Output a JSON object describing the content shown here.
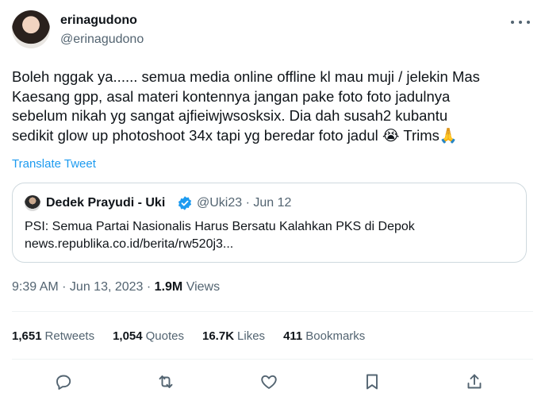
{
  "author": {
    "name": "erinagudono",
    "handle": "@erinagudono"
  },
  "tweet": {
    "text": "Boleh nggak ya...... semua media online offline kl mau muji / jelekin Mas\nKaesang gpp, asal materi kontennya jangan pake foto foto jadulnya\nsebelum nikah yg sangat ajfieiwjwsosksix. Dia dah susah2 kubantu\nsedikit glow up photoshoot 34x tapi yg beredar foto jadul 😭 Trims🙏",
    "translate_label": "Translate Tweet"
  },
  "quote": {
    "name": "Dedek Prayudi - Uki",
    "handle": "@Uki23",
    "date": "Jun 12",
    "text_line1": "PSI: Semua Partai Nasionalis Harus Bersatu Kalahkan PKS di Depok",
    "text_line2": "news.republika.co.id/berita/rw520j3..."
  },
  "meta": {
    "time": "9:39 AM",
    "date": "Jun 13, 2023",
    "views_count": "1.9M",
    "views_label": "Views"
  },
  "stats": [
    {
      "count": "1,651",
      "label": "Retweets"
    },
    {
      "count": "1,054",
      "label": "Quotes"
    },
    {
      "count": "16.7K",
      "label": "Likes"
    },
    {
      "count": "411",
      "label": "Bookmarks"
    }
  ],
  "actions": [
    "reply-icon",
    "retweet-icon",
    "like-icon",
    "bookmark-icon",
    "share-icon"
  ],
  "colors": {
    "link": "#1d9bf0",
    "secondary": "#536471",
    "verified": "#1d9bf0",
    "border": "#cfd9de"
  }
}
